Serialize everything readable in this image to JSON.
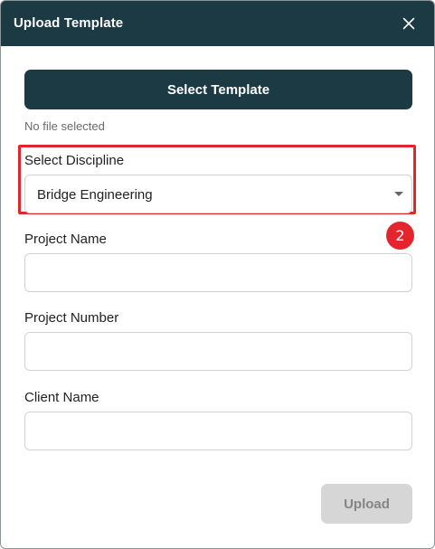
{
  "dialog": {
    "title": "Upload Template",
    "close_icon": "close-icon"
  },
  "template": {
    "select_button_label": "Select Template",
    "file_status": "No file selected"
  },
  "discipline": {
    "label": "Select Discipline",
    "selected_value": "Bridge Engineering",
    "dropdown_icon": "chevron-down-icon"
  },
  "annotation": {
    "step_number": "2",
    "highlight_color": "#e0262d"
  },
  "fields": {
    "project_name_label": "Project Name",
    "project_name_value": "",
    "project_number_label": "Project Number",
    "project_number_value": "",
    "client_name_label": "Client Name",
    "client_name_value": ""
  },
  "footer": {
    "upload_label": "Upload",
    "upload_enabled": false
  },
  "colors": {
    "header_bg": "#1b3a44",
    "primary_button": "#1b3a44",
    "disabled_button": "#d6d6d6",
    "badge": "#e3262d"
  }
}
